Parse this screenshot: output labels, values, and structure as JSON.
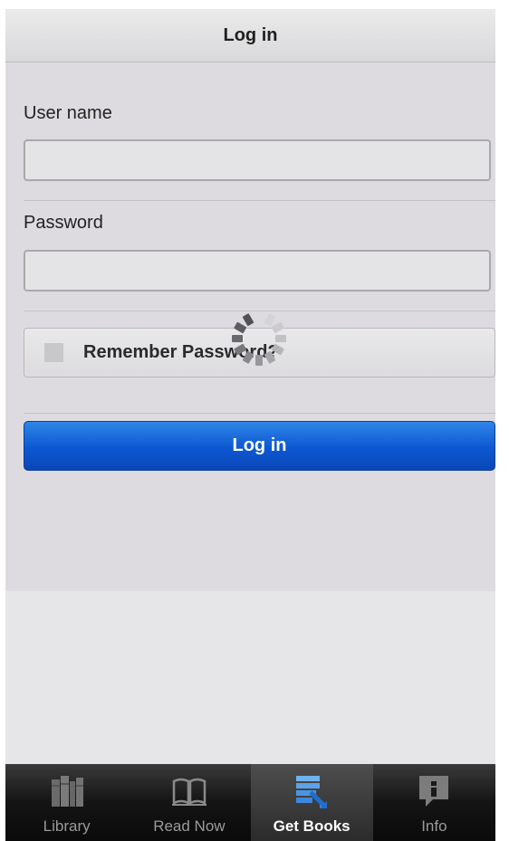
{
  "header": {
    "title": "Log in"
  },
  "form": {
    "username_label": "User name",
    "username_value": "",
    "password_label": "Password",
    "password_value": "",
    "remember_label": "Remember Password?",
    "remember_checked": false,
    "login_button_label": "Log in",
    "loading": true
  },
  "tabbar": {
    "tabs": [
      {
        "label": "Library",
        "icon": "library-icon",
        "active": false
      },
      {
        "label": "Read Now",
        "icon": "book-icon",
        "active": false
      },
      {
        "label": "Get Books",
        "icon": "get-books-icon",
        "active": true
      },
      {
        "label": "Info",
        "icon": "info-icon",
        "active": false
      }
    ]
  },
  "colors": {
    "primary_button": "#0d58d2",
    "tabbar_background": "#141414",
    "active_tab_label": "#ffffff",
    "inactive_tab_label": "#9a9a9a"
  }
}
